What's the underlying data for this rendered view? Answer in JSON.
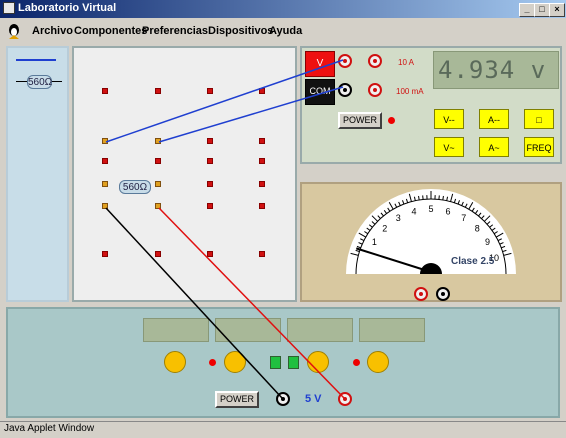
{
  "window": {
    "title": "Laboratorio Virtual",
    "btn_min": "_",
    "btn_max": "□",
    "btn_close": "×"
  },
  "menu": {
    "items": [
      "Archivo",
      "Componentes",
      "Preferencias",
      "Dispositivos",
      "Ayuda"
    ]
  },
  "left_panel": {
    "resistor_label": "560Ω"
  },
  "board": {
    "resistor_label": "560Ω"
  },
  "multimeter": {
    "display": "4.934 v",
    "v_label": "V",
    "com_label": "COM",
    "range_10a": "10 A",
    "range_100ma": "100 mA",
    "power_label": "POWER",
    "buttons": [
      "V--",
      "A--",
      "□",
      "V~",
      "A~",
      "FREQ"
    ]
  },
  "gauge": {
    "ticks": [
      "1",
      "2",
      "3",
      "4",
      "5",
      "6",
      "7",
      "8",
      "9",
      "10"
    ],
    "class_label": "Clase 2.5",
    "needle_value": 0.3
  },
  "power_supply": {
    "power_label": "POWER",
    "voltage_label": "5 V"
  },
  "status": {
    "text": "Java Applet Window"
  },
  "colors": {
    "accent_red": "#d01010",
    "panel_teal": "#a9c8c8",
    "wire_blue": "#1f3fd0"
  }
}
